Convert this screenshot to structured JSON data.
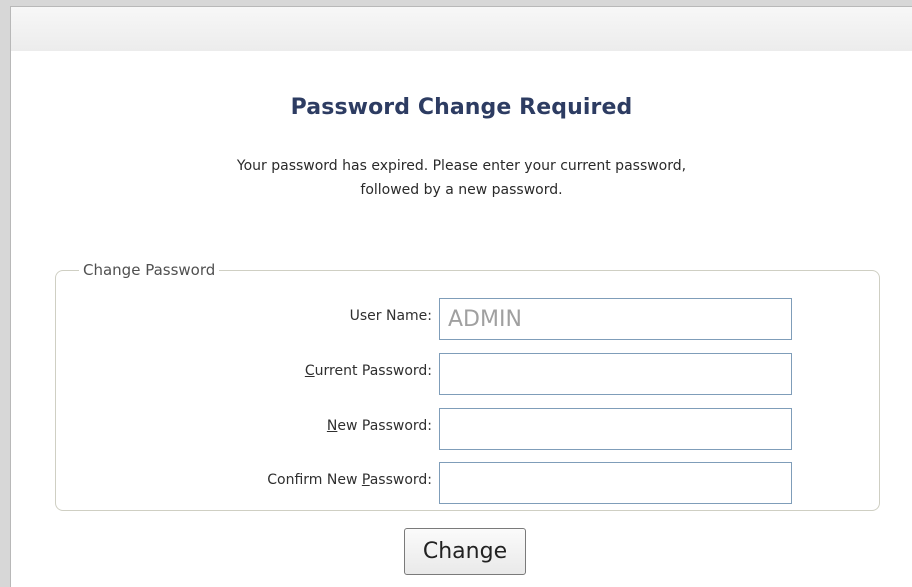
{
  "window": {
    "title": "Password Change Required",
    "message_line1": "Your password has expired. Please enter your current password,",
    "message_line2": "followed by a new password."
  },
  "form": {
    "legend": "Change Password",
    "fields": [
      {
        "label_prefix": "",
        "label_access": "",
        "label_suffix": "User Name:",
        "value": "ADMIN"
      },
      {
        "label_prefix": "",
        "label_access": "C",
        "label_suffix": "urrent Password:",
        "value": ""
      },
      {
        "label_prefix": "",
        "label_access": "N",
        "label_suffix": "ew Password:",
        "value": ""
      },
      {
        "label_prefix": "Confirm New ",
        "label_access": "P",
        "label_suffix": "assword:",
        "value": ""
      }
    ],
    "submit_label": "Change"
  }
}
